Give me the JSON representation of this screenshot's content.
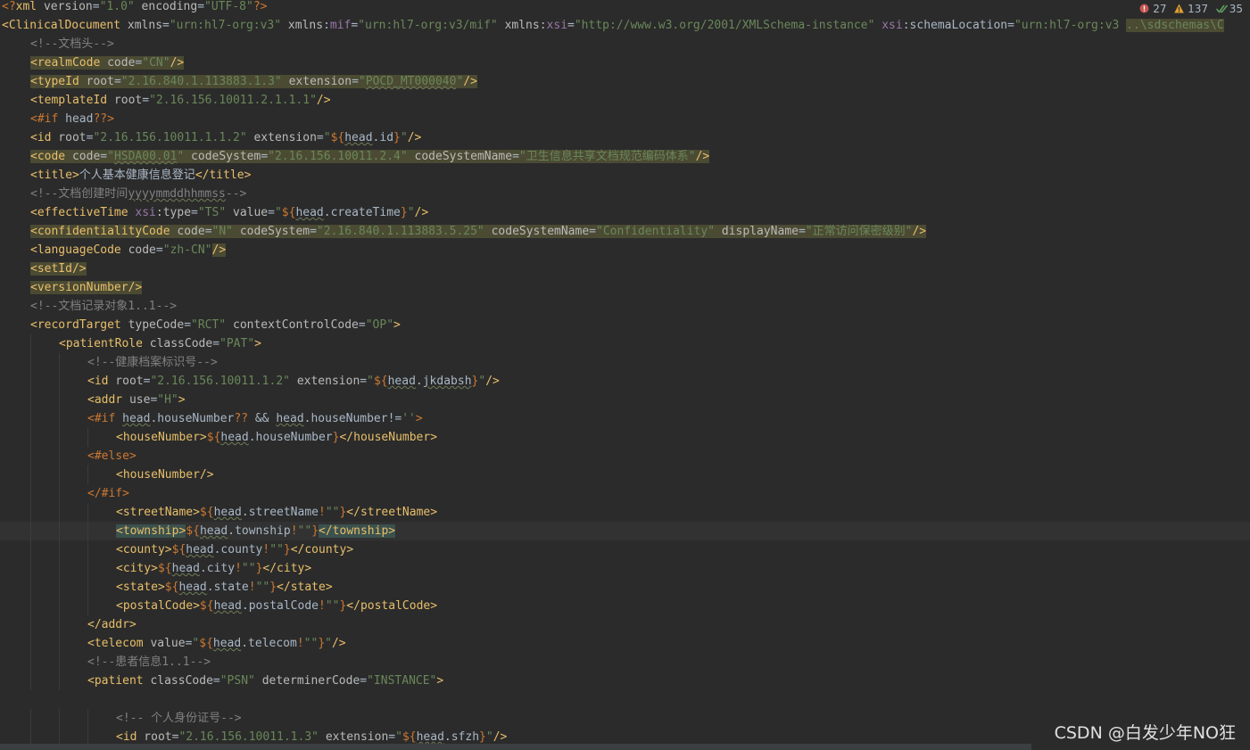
{
  "inspection": {
    "errors": "27",
    "warnings": "137",
    "ok": "35"
  },
  "watermark": "CSDN @白发少年NO狂",
  "lines": [
    {
      "segs": [
        [
          "k",
          "<?"
        ],
        [
          "t",
          "xml"
        ],
        [
          "a",
          " version"
        ],
        [
          "e",
          "="
        ],
        [
          "v",
          "\"1.0\""
        ],
        [
          "a",
          " encoding"
        ],
        [
          "e",
          "="
        ],
        [
          "v",
          "\"UTF-8\""
        ],
        [
          "k",
          "?>"
        ]
      ]
    },
    {
      "segs": [
        [
          "t",
          "<ClinicalDocument"
        ],
        [
          "a",
          " xmlns"
        ],
        [
          "e",
          "="
        ],
        [
          "v",
          "\"urn:hl7-org:v3\""
        ],
        [
          "a",
          " xmlns"
        ],
        [
          "e",
          ":"
        ],
        [
          "p",
          "mif"
        ],
        [
          "e",
          "="
        ],
        [
          "v",
          "\"urn:hl7-org:v3/mif\""
        ],
        [
          "a",
          " xmlns"
        ],
        [
          "e",
          ":"
        ],
        [
          "p",
          "xsi"
        ],
        [
          "e",
          "="
        ],
        [
          "v",
          "\"http://www.w3.org/2001/XMLSchema-instance\""
        ],
        [
          "e",
          " "
        ],
        [
          "p",
          "xsi"
        ],
        [
          "e",
          ":schemaLocation="
        ],
        [
          "v",
          "\"urn:hl7-org:v3 "
        ],
        [
          "v hl",
          "..\\sdschemas\\C"
        ]
      ]
    },
    {
      "segs": [
        [
          "c",
          "<!--文档头-->"
        ]
      ]
    },
    {
      "segs": [
        [
          "t hl",
          "<realmCode"
        ],
        [
          "a hl",
          " code"
        ],
        [
          "e hl",
          "="
        ],
        [
          "v hl",
          "\"CN\""
        ],
        [
          "t hl",
          "/>"
        ]
      ]
    },
    {
      "segs": [
        [
          "t hl",
          "<typeId"
        ],
        [
          "a hl",
          " root"
        ],
        [
          "e hl",
          "="
        ],
        [
          "v hl",
          "\"2.16.840.1.113883.1.3\""
        ],
        [
          "a hl",
          " extension"
        ],
        [
          "e hl",
          "="
        ],
        [
          "v hl",
          "\""
        ],
        [
          "v hl uw",
          "POCD_MT000040"
        ],
        [
          "v hl",
          "\""
        ],
        [
          "t hl",
          "/>"
        ]
      ]
    },
    {
      "segs": [
        [
          "t",
          "<templateId"
        ],
        [
          "a",
          " root"
        ],
        [
          "e",
          "="
        ],
        [
          "v",
          "\"2.16.156.10011.2.1.1.1\""
        ],
        [
          "t",
          "/>"
        ]
      ]
    },
    {
      "segs": [
        [
          "k",
          "<#if"
        ],
        [
          "e",
          " head"
        ],
        [
          "k",
          "??"
        ],
        [
          "k",
          ">"
        ]
      ]
    },
    {
      "segs": [
        [
          "t",
          "<id"
        ],
        [
          "a",
          " root"
        ],
        [
          "e",
          "="
        ],
        [
          "v",
          "\"2.16.156.10011.1.1.2\""
        ],
        [
          "a",
          " extension"
        ],
        [
          "e",
          "="
        ],
        [
          "v",
          "\""
        ],
        [
          "k",
          "${"
        ],
        [
          "e uw",
          "head"
        ],
        [
          "e",
          ".id"
        ],
        [
          "k",
          "}"
        ],
        [
          "v",
          "\""
        ],
        [
          "t",
          "/>"
        ]
      ]
    },
    {
      "segs": [
        [
          "t hl",
          "<code"
        ],
        [
          "a hl",
          " code"
        ],
        [
          "e hl",
          "="
        ],
        [
          "v hl",
          "\""
        ],
        [
          "v hl uw",
          "HSDA00.01"
        ],
        [
          "v hl",
          "\""
        ],
        [
          "a hl",
          " codeSystem"
        ],
        [
          "e hl",
          "="
        ],
        [
          "v hl",
          "\"2.16.156.10011.2.4\""
        ],
        [
          "a hl",
          " codeSystemName"
        ],
        [
          "e hl",
          "="
        ],
        [
          "v hl",
          "\"卫生信息共享文档规范编码体系\""
        ],
        [
          "t hl",
          "/>"
        ]
      ]
    },
    {
      "segs": [
        [
          "t",
          "<title>"
        ],
        [
          "e",
          "个人基本健康信息登记"
        ],
        [
          "t",
          "</title>"
        ]
      ]
    },
    {
      "segs": [
        [
          "c",
          "<!--文档创建时间"
        ],
        [
          "c uw",
          "yyyymmddhhmmss"
        ],
        [
          "c",
          "-->"
        ]
      ]
    },
    {
      "segs": [
        [
          "t",
          "<effectiveTime"
        ],
        [
          "a",
          " "
        ],
        [
          "p",
          "xsi"
        ],
        [
          "a",
          ":type"
        ],
        [
          "e",
          "="
        ],
        [
          "v",
          "\"TS\""
        ],
        [
          "a",
          " value"
        ],
        [
          "e",
          "="
        ],
        [
          "v",
          "\""
        ],
        [
          "k",
          "${"
        ],
        [
          "e uw",
          "head"
        ],
        [
          "e",
          ".createTime"
        ],
        [
          "k",
          "}"
        ],
        [
          "v",
          "\""
        ],
        [
          "t",
          "/>"
        ]
      ]
    },
    {
      "segs": [
        [
          "t hl",
          "<confidentialityCode"
        ],
        [
          "a hl",
          " code"
        ],
        [
          "e hl",
          "="
        ],
        [
          "v hl",
          "\"N\""
        ],
        [
          "a hl",
          " codeSystem"
        ],
        [
          "e hl",
          "="
        ],
        [
          "v hl",
          "\"2.16.840.1.113883.5.25\""
        ],
        [
          "a hl",
          " codeSystemName"
        ],
        [
          "e hl",
          "="
        ],
        [
          "v hl",
          "\"Confidentiality\""
        ],
        [
          "a hl",
          " displayName"
        ],
        [
          "e hl",
          "="
        ],
        [
          "v hl",
          "\"正常访问保密级别\""
        ],
        [
          "t hl",
          "/>"
        ]
      ]
    },
    {
      "segs": [
        [
          "t",
          "<languageCode"
        ],
        [
          "a",
          " code"
        ],
        [
          "e",
          "="
        ],
        [
          "v",
          "\"zh-CN\""
        ],
        [
          "t hl",
          "/>"
        ]
      ]
    },
    {
      "segs": [
        [
          "t hl",
          "<setId/>"
        ]
      ]
    },
    {
      "segs": [
        [
          "t hl",
          "<versionNumber/>"
        ]
      ]
    },
    {
      "segs": [
        [
          "c",
          "<!--文档记录对象1..1-->"
        ]
      ]
    },
    {
      "segs": [
        [
          "t",
          "<recordTarget"
        ],
        [
          "a",
          " typeCode"
        ],
        [
          "e",
          "="
        ],
        [
          "v",
          "\"RCT\""
        ],
        [
          "a",
          " contextControlCode"
        ],
        [
          "e",
          "="
        ],
        [
          "v",
          "\"OP\""
        ],
        [
          "t",
          ">"
        ]
      ]
    },
    {
      "segs": [
        [
          "t",
          "<patientRole"
        ],
        [
          "a",
          " classCode"
        ],
        [
          "e",
          "="
        ],
        [
          "v",
          "\"PAT\""
        ],
        [
          "t",
          ">"
        ]
      ]
    },
    {
      "segs": [
        [
          "c",
          "<!--健康档案标识号-->"
        ]
      ]
    },
    {
      "segs": [
        [
          "t",
          "<id"
        ],
        [
          "a",
          " root"
        ],
        [
          "e",
          "="
        ],
        [
          "v",
          "\"2.16.156.10011.1.2\""
        ],
        [
          "a",
          " extension"
        ],
        [
          "e",
          "="
        ],
        [
          "v",
          "\""
        ],
        [
          "k",
          "${"
        ],
        [
          "e uw",
          "head"
        ],
        [
          "e",
          "."
        ],
        [
          "e uw",
          "jkdabsh"
        ],
        [
          "k",
          "}"
        ],
        [
          "v",
          "\""
        ],
        [
          "t",
          "/>"
        ]
      ]
    },
    {
      "segs": [
        [
          "t",
          "<addr"
        ],
        [
          "a",
          " use"
        ],
        [
          "e",
          "="
        ],
        [
          "v",
          "\"H\""
        ],
        [
          "t",
          ">"
        ]
      ]
    },
    {
      "segs": [
        [
          "k",
          "<#if"
        ],
        [
          "e",
          " "
        ],
        [
          "e uw",
          "head"
        ],
        [
          "e",
          ".houseNumber"
        ],
        [
          "k",
          "??"
        ],
        [
          "e",
          " && "
        ],
        [
          "e uw",
          "head"
        ],
        [
          "e",
          ".houseNumber!="
        ],
        [
          "v",
          "''"
        ],
        [
          "k",
          ">"
        ]
      ]
    },
    {
      "segs": [
        [
          "t",
          "<houseNumber>"
        ],
        [
          "k",
          "${"
        ],
        [
          "e uw",
          "head"
        ],
        [
          "e",
          ".houseNumber"
        ],
        [
          "k",
          "}"
        ],
        [
          "t",
          "</houseNumber>"
        ]
      ]
    },
    {
      "segs": [
        [
          "k",
          "<#else>"
        ]
      ]
    },
    {
      "segs": [
        [
          "t",
          "<houseNumber/>"
        ]
      ]
    },
    {
      "segs": [
        [
          "k",
          "</#if>"
        ]
      ]
    },
    {
      "segs": [
        [
          "t",
          "<streetName>"
        ],
        [
          "k",
          "${"
        ],
        [
          "e uw",
          "head"
        ],
        [
          "e",
          ".streetName"
        ],
        [
          "k",
          "!"
        ],
        [
          "v",
          "\"\""
        ],
        [
          "k",
          "}"
        ],
        [
          "t",
          "</streetName>"
        ]
      ]
    },
    {
      "segs": [
        [
          "t hlm",
          "<township>"
        ],
        [
          "k",
          "${"
        ],
        [
          "e uw",
          "head"
        ],
        [
          "e",
          ".township"
        ],
        [
          "k",
          "!"
        ],
        [
          "v",
          "\"\""
        ],
        [
          "k",
          "}"
        ],
        [
          "t hlm",
          "</township>"
        ]
      ]
    },
    {
      "segs": [
        [
          "t",
          "<county>"
        ],
        [
          "k",
          "${"
        ],
        [
          "e uw",
          "head"
        ],
        [
          "e",
          ".county"
        ],
        [
          "k",
          "!"
        ],
        [
          "v",
          "\"\""
        ],
        [
          "k",
          "}"
        ],
        [
          "t",
          "</county>"
        ]
      ]
    },
    {
      "segs": [
        [
          "t",
          "<city>"
        ],
        [
          "k",
          "${"
        ],
        [
          "e uw",
          "head"
        ],
        [
          "e",
          ".city"
        ],
        [
          "k",
          "!"
        ],
        [
          "v",
          "\"\""
        ],
        [
          "k",
          "}"
        ],
        [
          "t",
          "</city>"
        ]
      ]
    },
    {
      "segs": [
        [
          "t",
          "<state>"
        ],
        [
          "k",
          "${"
        ],
        [
          "e uw",
          "head"
        ],
        [
          "e",
          ".state"
        ],
        [
          "k",
          "!"
        ],
        [
          "v",
          "\"\""
        ],
        [
          "k",
          "}"
        ],
        [
          "t",
          "</state>"
        ]
      ]
    },
    {
      "segs": [
        [
          "t",
          "<postalCode>"
        ],
        [
          "k",
          "${"
        ],
        [
          "e uw",
          "head"
        ],
        [
          "e",
          ".postalCode"
        ],
        [
          "k",
          "!"
        ],
        [
          "v",
          "\"\""
        ],
        [
          "k",
          "}"
        ],
        [
          "t",
          "</postalCode>"
        ]
      ]
    },
    {
      "segs": [
        [
          "t",
          "</addr>"
        ]
      ]
    },
    {
      "segs": [
        [
          "t",
          "<telecom"
        ],
        [
          "a",
          " value"
        ],
        [
          "e",
          "="
        ],
        [
          "v",
          "\""
        ],
        [
          "k",
          "${"
        ],
        [
          "e uw",
          "head"
        ],
        [
          "e",
          ".telecom"
        ],
        [
          "k",
          "!"
        ],
        [
          "v",
          "\"\""
        ],
        [
          "k",
          "}"
        ],
        [
          "v",
          "\""
        ],
        [
          "t",
          "/>"
        ]
      ]
    },
    {
      "segs": [
        [
          "c",
          "<!--患者信息1..1-->"
        ]
      ]
    },
    {
      "segs": [
        [
          "t",
          "<patient"
        ],
        [
          "a",
          " classCode"
        ],
        [
          "e",
          "="
        ],
        [
          "v",
          "\"PSN\""
        ],
        [
          "a",
          " determinerCode"
        ],
        [
          "e",
          "="
        ],
        [
          "v",
          "\"INSTANCE\""
        ],
        [
          "t",
          ">"
        ]
      ]
    },
    {
      "segs": []
    },
    {
      "segs": [
        [
          "c",
          "<!-- 个人身份证号-->"
        ]
      ]
    },
    {
      "segs": [
        [
          "t",
          "<id"
        ],
        [
          "a",
          " root"
        ],
        [
          "e",
          "="
        ],
        [
          "v",
          "\"2.16.156.10011.1.3\""
        ],
        [
          "a",
          " extension"
        ],
        [
          "e",
          "="
        ],
        [
          "v",
          "\""
        ],
        [
          "k",
          "${"
        ],
        [
          "e uw",
          "head"
        ],
        [
          "e",
          ".sfzh"
        ],
        [
          "k",
          "}"
        ],
        [
          "v",
          "\""
        ],
        [
          "t",
          "/>"
        ]
      ]
    }
  ]
}
